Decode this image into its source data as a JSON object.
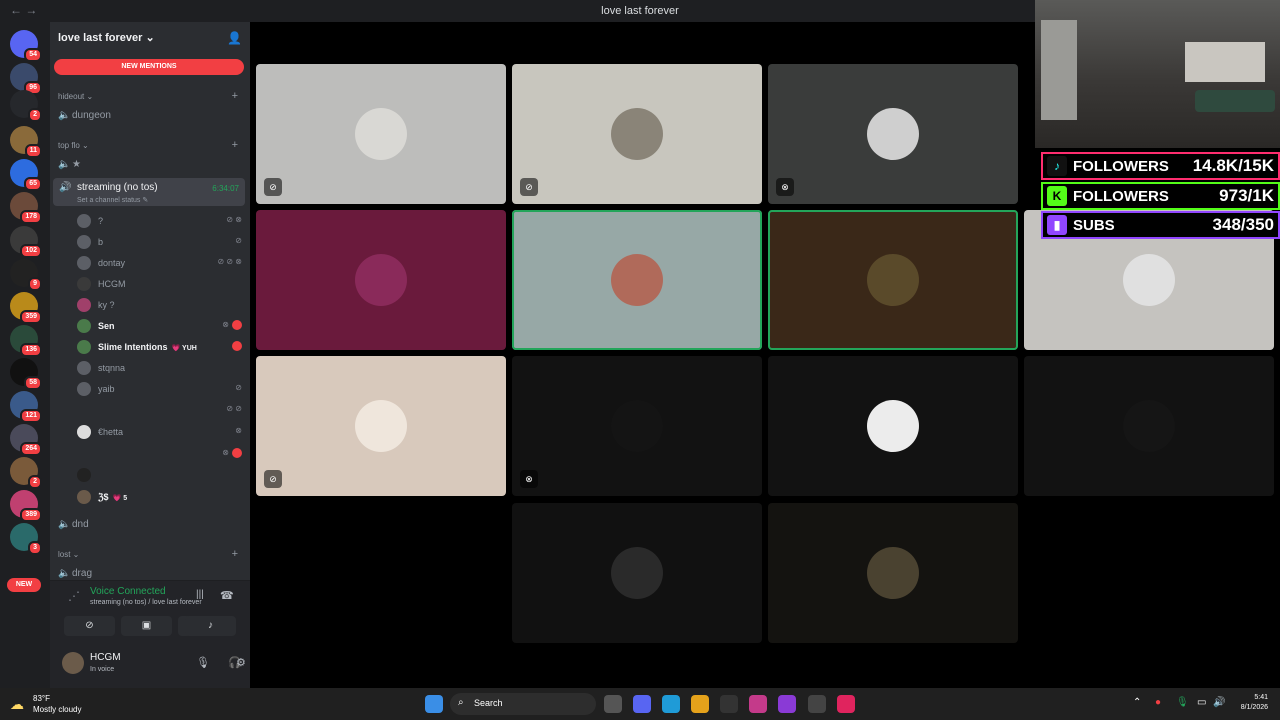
{
  "window": {
    "title": "love last forever",
    "nav": "← →"
  },
  "guilds": {
    "badges": [
      "54",
      "96",
      "2",
      "11",
      "65",
      "178",
      "102",
      "9",
      "359",
      "136",
      "58",
      "121",
      "264",
      "2",
      "389",
      "3"
    ],
    "new_label": "NEW"
  },
  "sidebar": {
    "server_name": "love last forever",
    "new_mentions": "NEW MENTIONS",
    "categories": {
      "hideout": "hideout",
      "top_flo": "top flo",
      "lost": "lost"
    },
    "channels": {
      "dungeon": "dungeon",
      "star": "★",
      "dnd": "dnd",
      "drag": "drag"
    },
    "active_channel": {
      "name": "streaming (no tos)",
      "status": "Set a channel status",
      "timer": "6:34:07"
    },
    "users": [
      {
        "name": "?"
      },
      {
        "name": "b"
      },
      {
        "name": "dontay"
      },
      {
        "name": "HCGM"
      },
      {
        "name": "ky ?"
      },
      {
        "name": "Sen"
      },
      {
        "name": "Slime Intentions",
        "tag": "💗 YUH"
      },
      {
        "name": "stqnna"
      },
      {
        "name": "yaib"
      },
      {
        "name": ""
      },
      {
        "name": "€hetta"
      },
      {
        "name": ""
      },
      {
        "name": ""
      },
      {
        "name": "ℨ$",
        "tag": "💗 5"
      }
    ],
    "voice": {
      "status": "Voice Connected",
      "location": "streaming (no tos) / love last forever"
    },
    "me": {
      "name": "HCGM",
      "status": "In voice"
    }
  },
  "overlay": {
    "stats": [
      {
        "label": "FOLLOWERS",
        "value": "14.8K/15K",
        "color": "#ff2d6f",
        "logo": "♪"
      },
      {
        "label": "FOLLOWERS",
        "value": "973/1K",
        "color": "#53fc18",
        "logo": "K"
      },
      {
        "label": "SUBS",
        "value": "348/350",
        "color": "#9146ff",
        "logo": "▮"
      }
    ]
  },
  "taskbar": {
    "weather_temp": "83°F",
    "weather_desc": "Mostly cloudy",
    "search": "Search",
    "time": "5:41",
    "date": "8/1/2026"
  }
}
